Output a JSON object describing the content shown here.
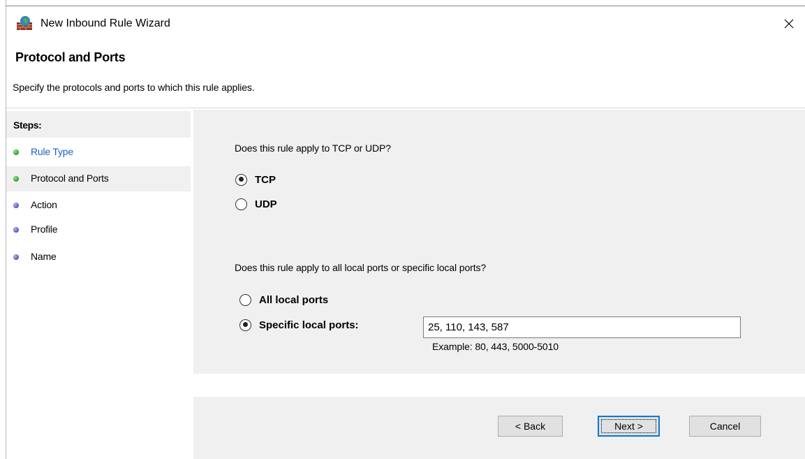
{
  "window": {
    "title": "New Inbound Rule Wizard",
    "icon": "firewall-globe-icon",
    "close_glyph": "✕"
  },
  "header": {
    "title": "Protocol and Ports",
    "subtitle": "Specify the protocols and ports to which this rule applies."
  },
  "steps": {
    "heading": "Steps:",
    "items": [
      {
        "label": "Rule Type",
        "dot_color": "#3aa83a",
        "state": "link"
      },
      {
        "label": "Protocol and Ports",
        "dot_color": "#3aa83a",
        "state": "current"
      },
      {
        "label": "Action",
        "dot_color": "#5a5fc8",
        "state": "pending"
      },
      {
        "label": "Profile",
        "dot_color": "#5a5fc8",
        "state": "pending"
      },
      {
        "label": "Name",
        "dot_color": "#5a5fc8",
        "state": "pending"
      }
    ]
  },
  "protocol": {
    "question": "Does this rule apply to TCP or UDP?",
    "options": [
      {
        "label": "TCP",
        "checked": true
      },
      {
        "label": "UDP",
        "checked": false
      }
    ]
  },
  "ports": {
    "question": "Does this rule apply to all local ports or specific local ports?",
    "options": [
      {
        "label": "All local ports",
        "checked": false
      },
      {
        "label": "Specific local ports:",
        "checked": true
      }
    ],
    "value": "25, 110, 143, 587",
    "example": "Example: 80, 443, 5000-5010"
  },
  "buttons": {
    "back": "< Back",
    "next": "Next >",
    "cancel": "Cancel"
  },
  "colors": {
    "panel_bg": "#f0f0f0",
    "link": "#1e5fc1",
    "focus_border": "#0078d7"
  }
}
